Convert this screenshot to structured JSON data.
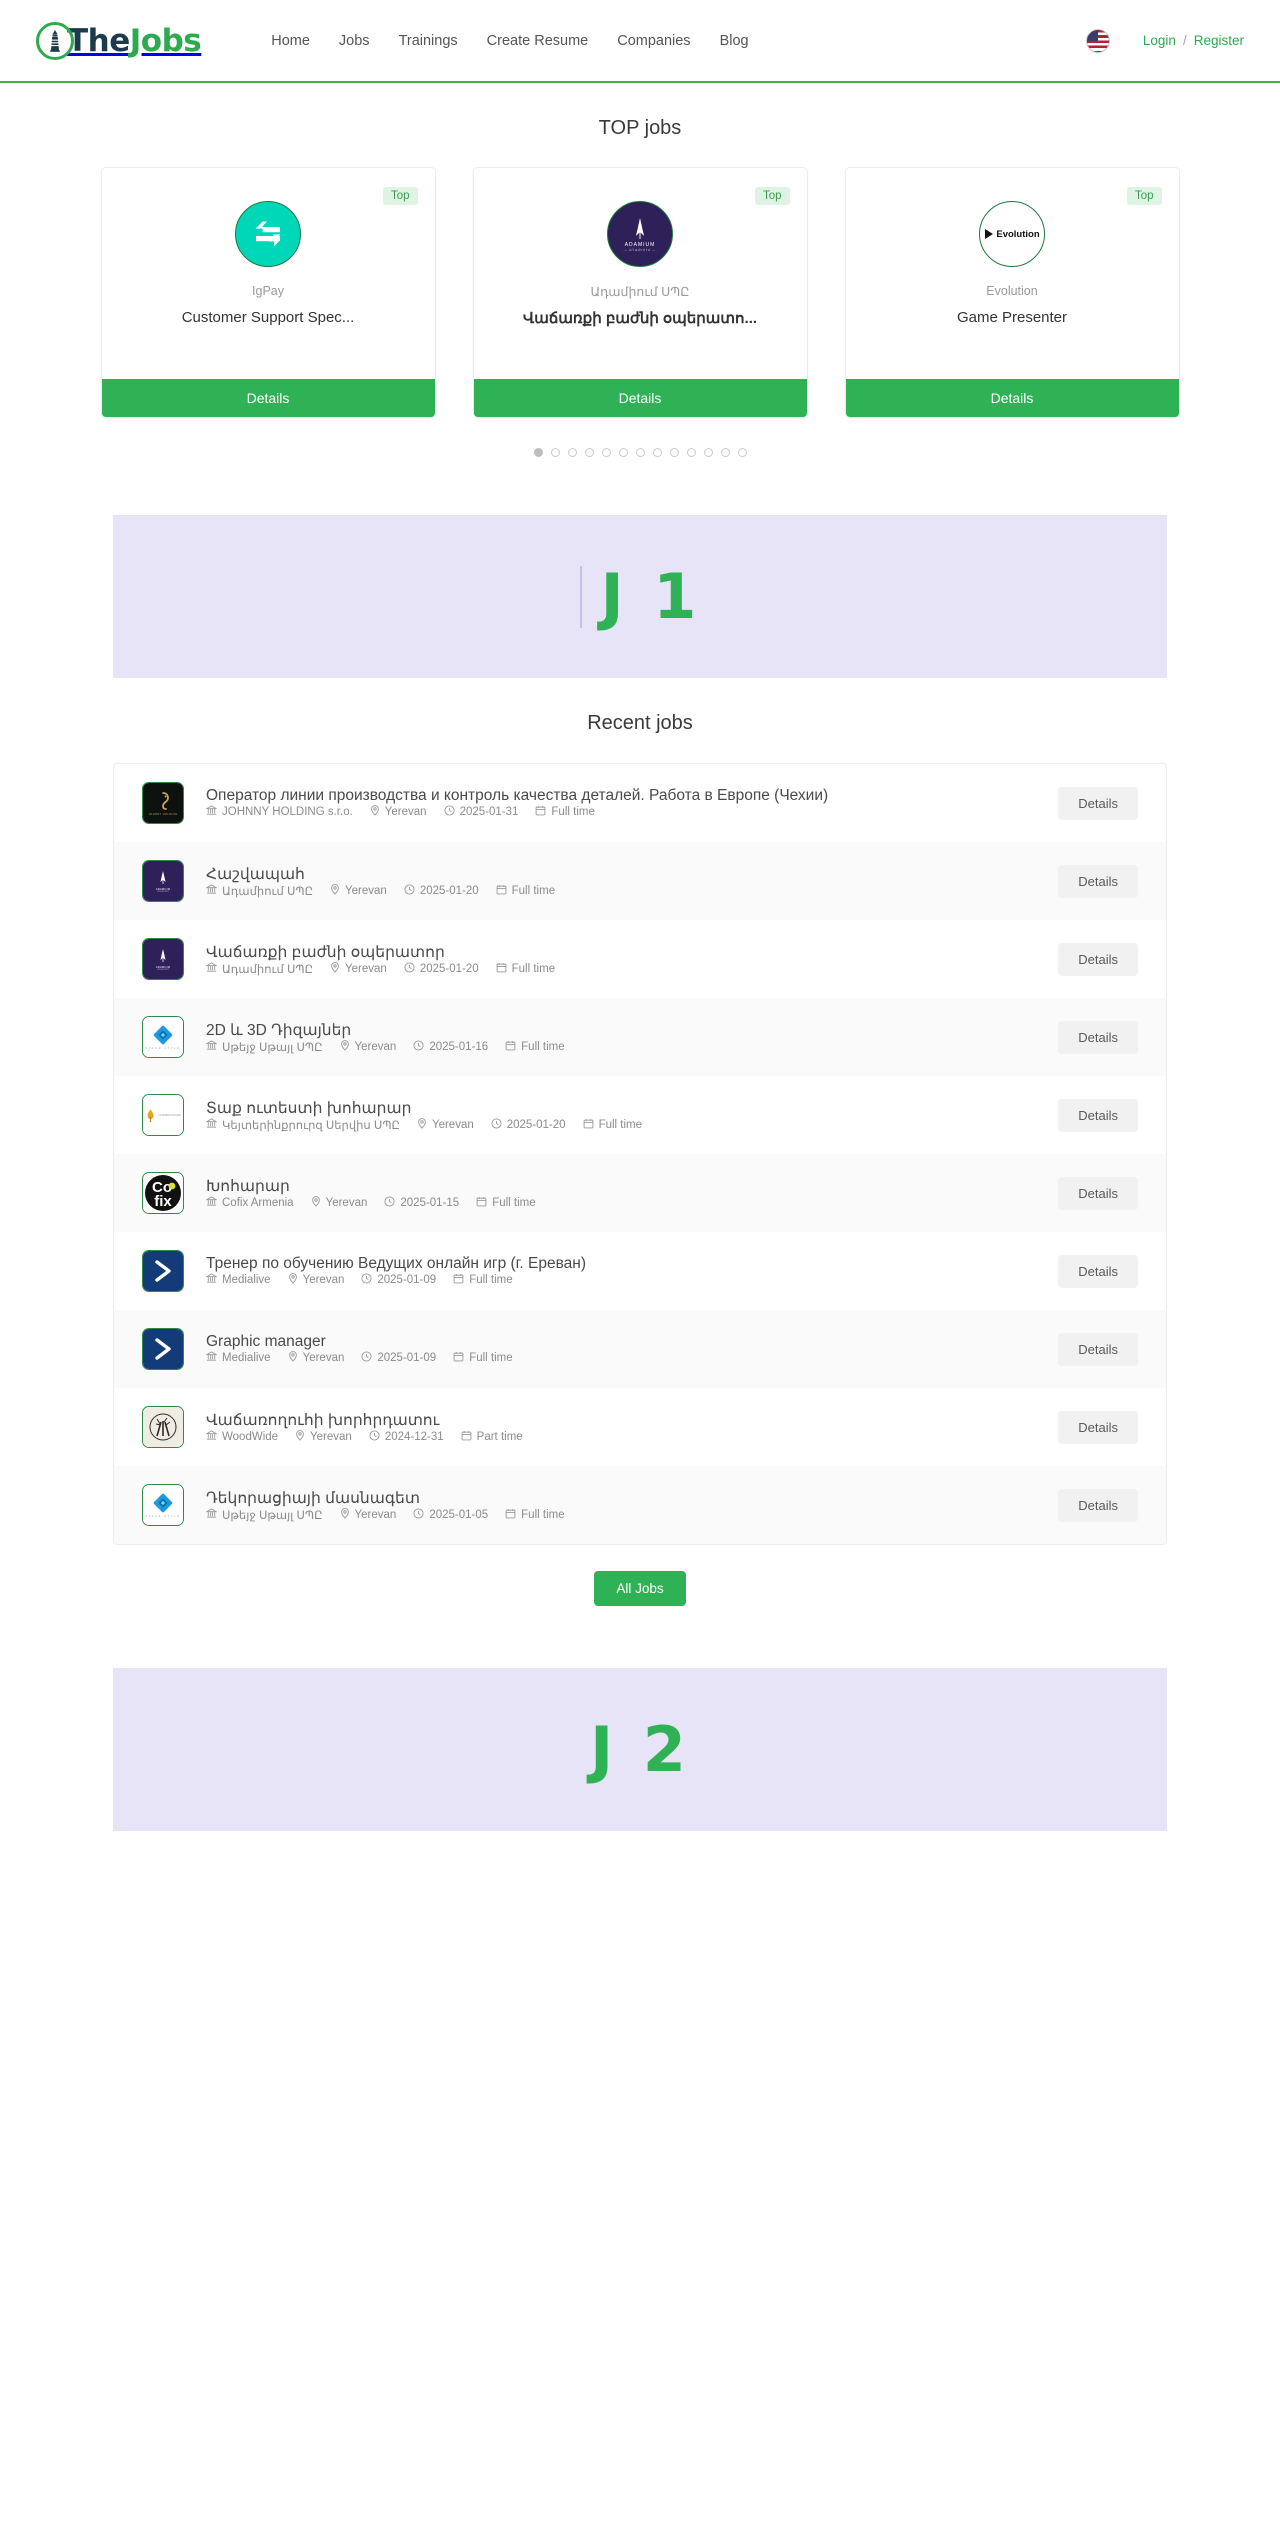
{
  "header": {
    "logo": {
      "icon": "lighthouse-icon",
      "text_dark": "The",
      "text_green": "Jobs"
    },
    "nav": [
      {
        "label": "Home"
      },
      {
        "label": "Jobs"
      },
      {
        "label": "Trainings"
      },
      {
        "label": "Create Resume"
      },
      {
        "label": "Companies"
      },
      {
        "label": "Blog"
      }
    ],
    "language": {
      "icon": "us-flag-icon",
      "name": "English"
    },
    "auth": {
      "login": "Login",
      "separator": "/",
      "register": "Register"
    }
  },
  "top_jobs": {
    "title": "TOP jobs",
    "badge_label": "Top",
    "details_label": "Details",
    "cards": [
      {
        "company": "IgPay",
        "title": "Customer Support Spec...",
        "badge": "Top",
        "logo": "igpay-logo",
        "bold": false
      },
      {
        "company": "Ադամիում ՍՊԸ",
        "title": "Վաճառքի բաժնի օպերատո...",
        "badge": "Top",
        "logo": "adamium-logo",
        "bold": true
      },
      {
        "company": "Evolution",
        "title": "Game Presenter",
        "badge": "Top",
        "logo": "evolution-logo",
        "bold": false
      }
    ],
    "dots_total": 13,
    "dot_active_index": 0
  },
  "ads": [
    {
      "label": "J 1"
    },
    {
      "label": "J 2"
    }
  ],
  "recent_jobs": {
    "title": "Recent jobs",
    "details_label": "Details",
    "all_jobs_label": "All Jobs",
    "rows": [
      {
        "title": "Оператор линии производства и контроль качества деталей. Работа в Европе (Чехии)",
        "company": "JOHNNY HOLDING s.r.o.",
        "location": "Yerevan",
        "date": "2025-01-31",
        "type": "Full time",
        "logo": "johnny-holding-logo"
      },
      {
        "title": "Հաշվապահ",
        "company": "Ադամիում ՍՊԸ",
        "location": "Yerevan",
        "date": "2025-01-20",
        "type": "Full time",
        "logo": "adamium-logo"
      },
      {
        "title": "Վաճառքի բաժնի օպերատոր",
        "company": "Ադամիում ՍՊԸ",
        "location": "Yerevan",
        "date": "2025-01-20",
        "type": "Full time",
        "logo": "adamium-logo"
      },
      {
        "title": "2D և 3D Դիզայներ",
        "company": "Սթեյջ Սթայլ ՍՊԸ",
        "location": "Yerevan",
        "date": "2025-01-16",
        "type": "Full time",
        "logo": "stage-style-logo"
      },
      {
        "title": "Տաք ուտեստի խոհարար",
        "company": "Կեյտերինքրուրզ Սերվիս ՍՊԸ",
        "location": "Yerevan",
        "date": "2025-01-20",
        "type": "Full time",
        "logo": "catering-logo"
      },
      {
        "title": "Խոհարար",
        "company": "Cofix Armenia",
        "location": "Yerevan",
        "date": "2025-01-15",
        "type": "Full time",
        "logo": "cofix-logo"
      },
      {
        "title": "Тренер по обучению Ведущих онлайн игр (г. Ереван)",
        "company": "Medialive",
        "location": "Yerevan",
        "date": "2025-01-09",
        "type": "Full time",
        "logo": "medialive-logo"
      },
      {
        "title": "Graphic manager",
        "company": "Medialive",
        "location": "Yerevan",
        "date": "2025-01-09",
        "type": "Full time",
        "logo": "medialive-logo"
      },
      {
        "title": "Վաճառողուհի խորհրդատու",
        "company": "WoodWide",
        "location": "Yerevan",
        "date": "2024-12-31",
        "type": "Part time",
        "logo": "woodwide-logo"
      },
      {
        "title": "Դեկորացիայի մասնագետ",
        "company": "Սթեյջ Սթայլ ՍՊԸ",
        "location": "Yerevan",
        "date": "2025-01-05",
        "type": "Full time",
        "logo": "stage-style-logo"
      }
    ]
  },
  "colors": {
    "brand_green": "#2fb155",
    "accent_dark": "#1b3a4b",
    "badge_bg": "#dff3e2",
    "ad_bg": "#e7e4f7"
  }
}
